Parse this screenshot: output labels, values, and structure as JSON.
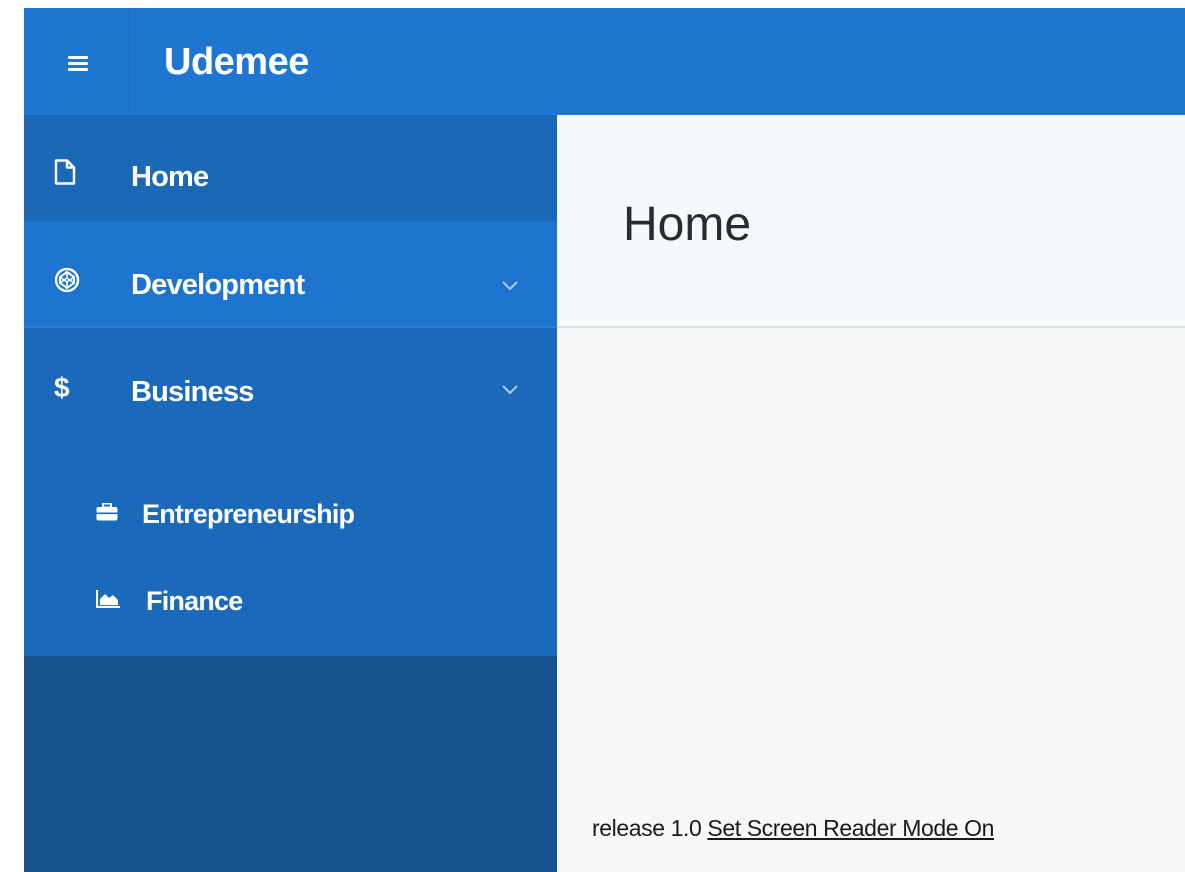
{
  "app": {
    "title": "Udemee",
    "brand_color": "#1e76d1"
  },
  "header": {
    "menu_icon": "hamburger-menu-icon"
  },
  "sidebar": {
    "items": [
      {
        "label": "Home",
        "icon": "file-icon",
        "expandable": false
      },
      {
        "label": "Development",
        "icon": "codepen-icon",
        "expandable": true,
        "expanded": false
      },
      {
        "label": "Business",
        "icon": "dollar-icon",
        "icon_glyph": "$",
        "expandable": true,
        "expanded": true,
        "children": [
          {
            "label": "Entrepreneurship",
            "icon": "briefcase-icon"
          },
          {
            "label": "Finance",
            "icon": "area-chart-icon"
          }
        ]
      }
    ],
    "colors": {
      "active": "#1a68b6",
      "hover": "#1d74cf",
      "background": "#16528d"
    }
  },
  "main": {
    "page_title": "Home"
  },
  "footer": {
    "release_text": "release 1.0",
    "screen_reader_link": "Set Screen Reader Mode On"
  }
}
